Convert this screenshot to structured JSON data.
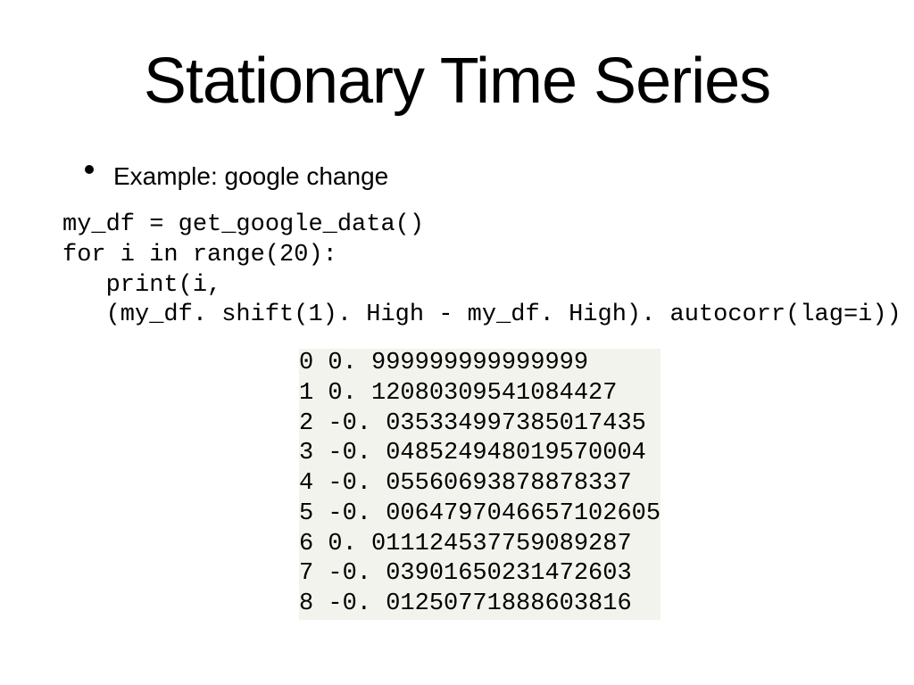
{
  "title": "Stationary Time Series",
  "bullet": "Example: google change",
  "code": "my_df = get_google_data()\nfor i in range(20):\n   print(i,\n   (my_df. shift(1). High - my_df. High). autocorr(lag=i))",
  "output": "0 0. 999999999999999\n1 0. 12080309541084427\n2 -0. 035334997385017435\n3 -0. 048524948019570004\n4 -0. 05560693878878337\n5 -0. 0064797046657102605\n6 0. 011124537759089287\n7 -0. 03901650231472603\n8 -0. 01250771888603816"
}
